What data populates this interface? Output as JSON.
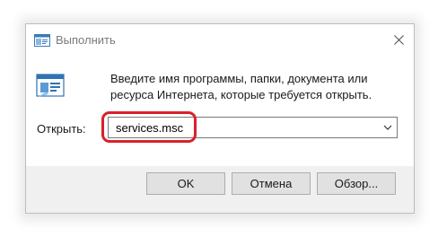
{
  "window": {
    "title": "Выполнить",
    "title_icon": "run-dialog-icon",
    "close_icon": "close-icon"
  },
  "content": {
    "description": "Введите имя программы, папки, документа или ресурса Интернета, которые требуется открыть.",
    "open_label": "Открыть:",
    "open_value": "services.msc",
    "dropdown_icon": "chevron-down-icon"
  },
  "buttons": {
    "ok": "OK",
    "cancel": "Отмена",
    "browse": "Обзор..."
  },
  "colors": {
    "highlight": "#d9212b",
    "dialog_bg": "#f0f0f0",
    "button_bg": "#e1e1e1"
  }
}
